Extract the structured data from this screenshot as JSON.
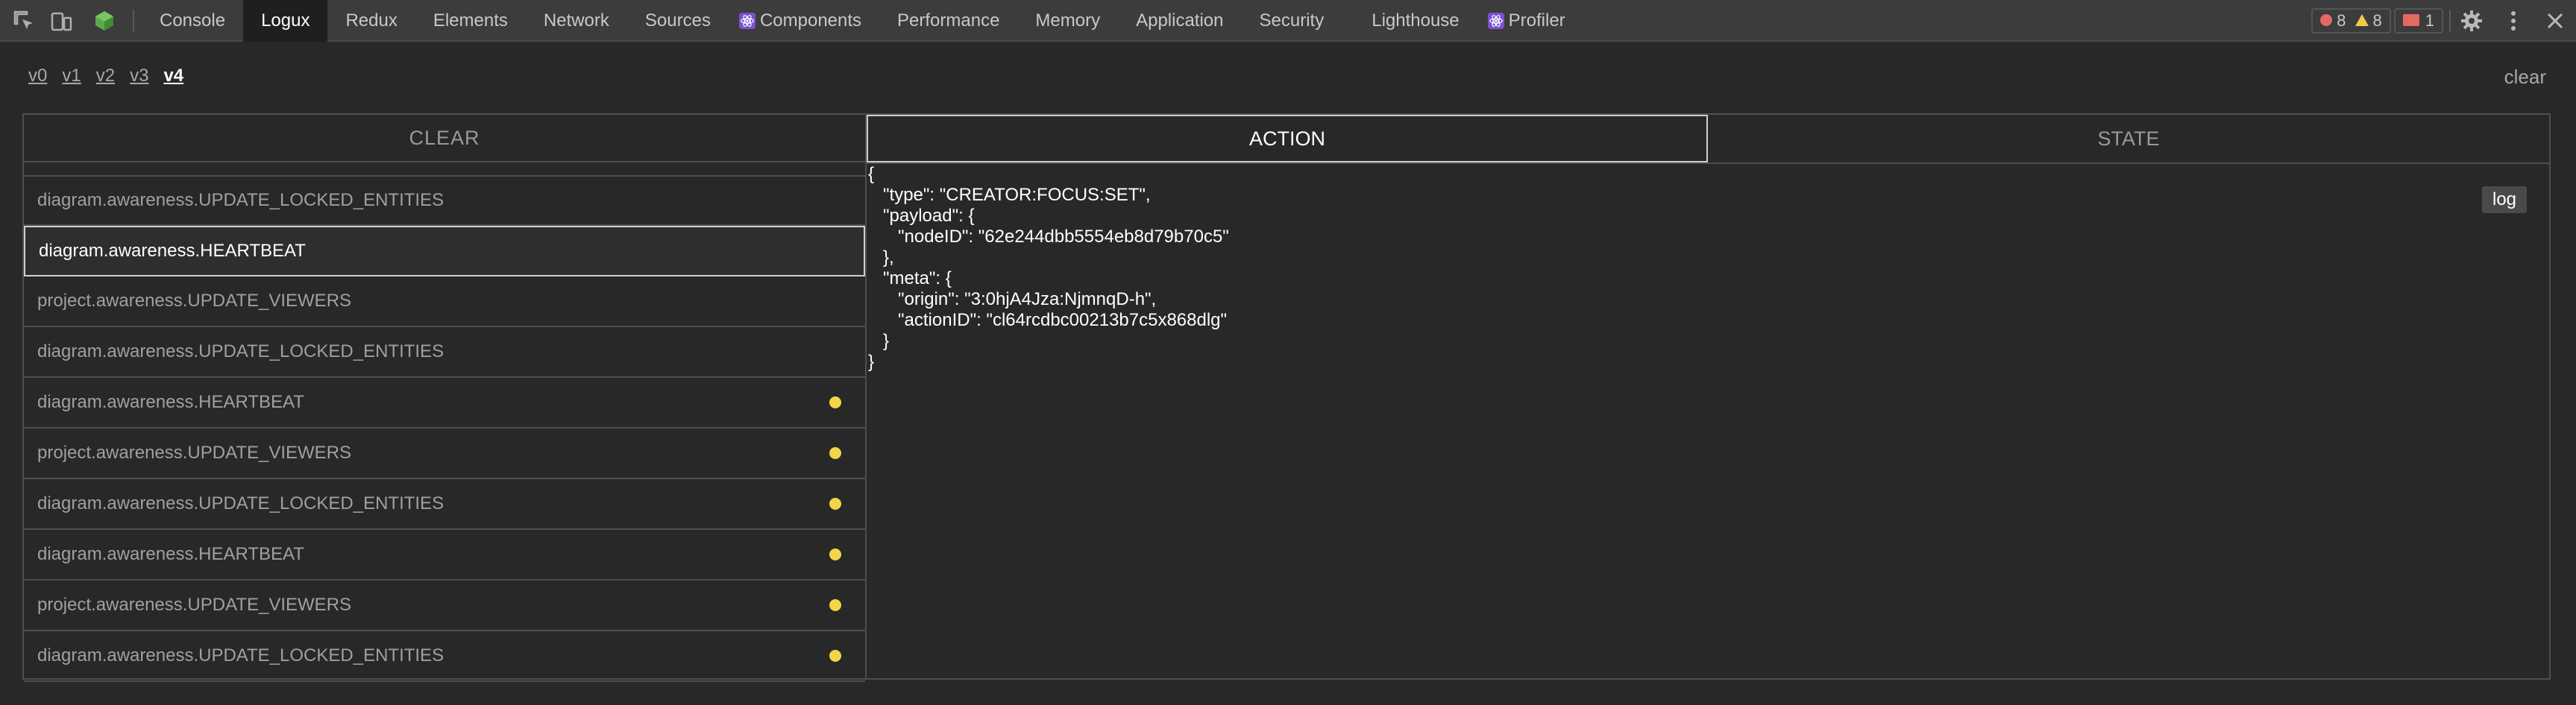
{
  "topbar": {
    "tabs": [
      {
        "label": "Console"
      },
      {
        "label": "Logux",
        "active": true
      },
      {
        "label": "Redux"
      },
      {
        "label": "Elements"
      },
      {
        "label": "Network"
      },
      {
        "label": "Sources"
      },
      {
        "label": "Components",
        "icon": "react-icon"
      },
      {
        "label": "Performance"
      },
      {
        "label": "Memory"
      },
      {
        "label": "Application"
      },
      {
        "label": "Security"
      },
      {
        "label": "Lighthouse"
      },
      {
        "label": "Profiler",
        "icon": "react-icon"
      }
    ],
    "errors": "8",
    "warnings": "8",
    "issues": "1",
    "colors": {
      "error": "#e46962",
      "warning": "#f2c94c",
      "bar": "#3c3c3c",
      "active_tab": "#1f1f1f"
    }
  },
  "versions": {
    "items": [
      "v0",
      "v1",
      "v2",
      "v3",
      "v4"
    ],
    "active": "v4",
    "clear_label": "clear"
  },
  "list_panel": {
    "header": "CLEAR",
    "rows": [
      {
        "label": "diagram.awareness.UPDATE_LOCKED_ENTITIES",
        "dot": false
      },
      {
        "label": "diagram.awareness.HEARTBEAT",
        "dot": false,
        "selected": true
      },
      {
        "label": "project.awareness.UPDATE_VIEWERS",
        "dot": false
      },
      {
        "label": "diagram.awareness.UPDATE_LOCKED_ENTITIES",
        "dot": false
      },
      {
        "label": "diagram.awareness.HEARTBEAT",
        "dot": true
      },
      {
        "label": "project.awareness.UPDATE_VIEWERS",
        "dot": true
      },
      {
        "label": "diagram.awareness.UPDATE_LOCKED_ENTITIES",
        "dot": true
      },
      {
        "label": "diagram.awareness.HEARTBEAT",
        "dot": true
      },
      {
        "label": "project.awareness.UPDATE_VIEWERS",
        "dot": true
      },
      {
        "label": "diagram.awareness.UPDATE_LOCKED_ENTITIES",
        "dot": true
      }
    ],
    "dot_color": "#f2d647"
  },
  "detail_panel": {
    "tabs": [
      {
        "label": "ACTION",
        "active": true
      },
      {
        "label": "STATE"
      }
    ],
    "code": "{\n   \"type\": \"CREATOR:FOCUS:SET\",\n   \"payload\": {\n      \"nodeID\": \"62e244dbb5554eb8d79b70c5\"\n   },\n   \"meta\": {\n      \"origin\": \"3:0hjA4Jza:NjmnqD-h\",\n      \"actionID\": \"cl64rcdbc00213b7c5x868dlg\"\n   }\n}",
    "log_label": "log"
  }
}
